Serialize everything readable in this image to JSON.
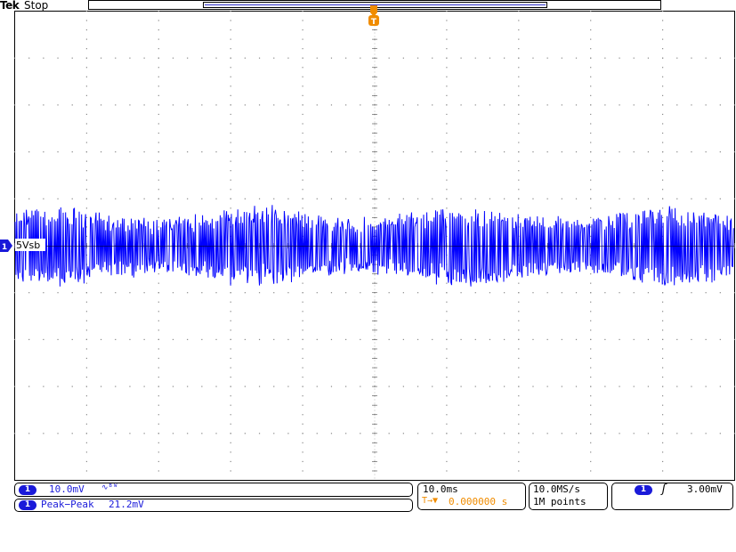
{
  "header": {
    "brand": "Tek",
    "state": "Stop"
  },
  "trigger_marker": {
    "glyph": "T",
    "color": "#f08c00"
  },
  "channel1": {
    "number": "1",
    "label": "5Vsb",
    "color": "#1a1ad9",
    "scale": "10.0mV",
    "coupling_icon": "bandwidth-limit-icon",
    "coupling_glyph": "∿ᴮᵂ"
  },
  "measurement": {
    "name": "Peak−Peak",
    "value": "21.2mV"
  },
  "timebase": {
    "scale": "10.0ms",
    "trigger_position": "0.000000 s",
    "trigger_position_glyph": "T→▼"
  },
  "acquisition": {
    "sample_rate": "10.0MS/s",
    "record_length": "1M points"
  },
  "trigger": {
    "source": "1",
    "slope_icon": "rising-edge-icon",
    "slope_glyph": "ʃ",
    "level": "3.00mV"
  },
  "colors": {
    "trace": "#0000ff",
    "trigger": "#f08c00",
    "grid": "#888888",
    "background": "#ffffff"
  }
}
